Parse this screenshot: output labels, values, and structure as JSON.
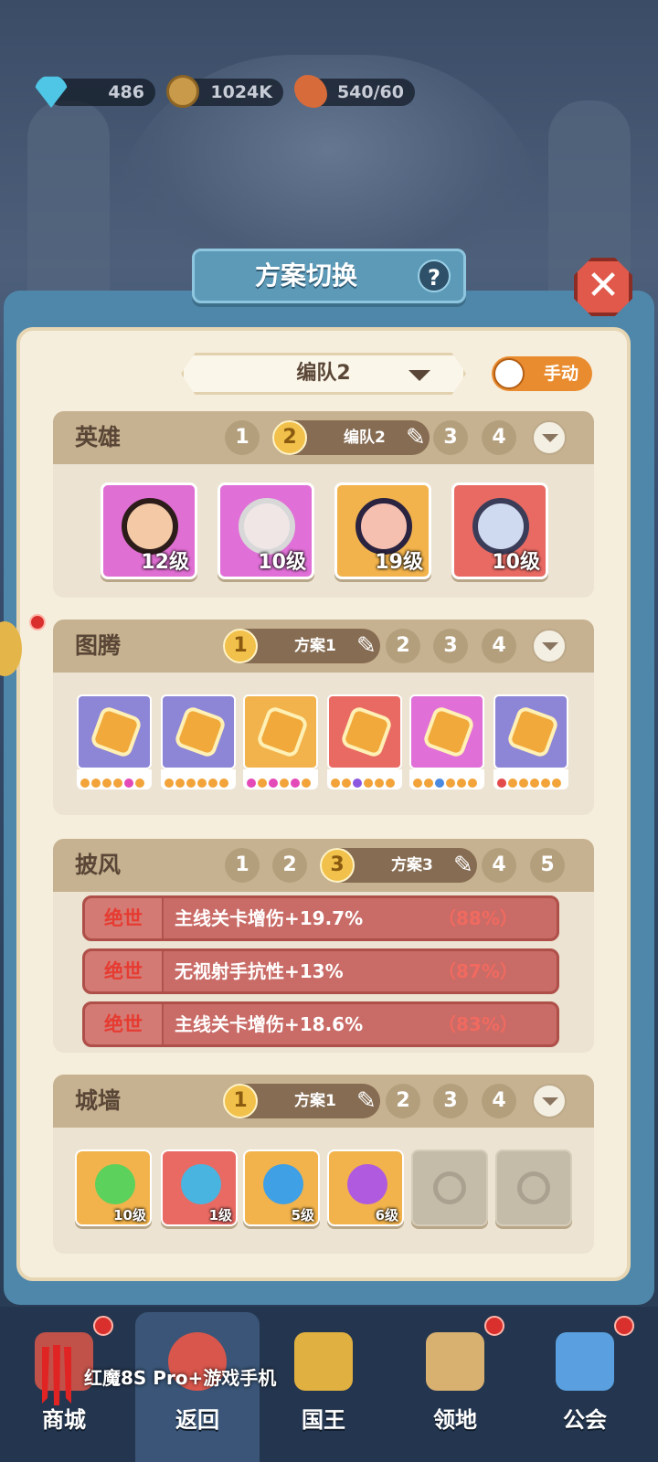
{
  "resources": [
    {
      "icon": "diamond-icon",
      "value": "486"
    },
    {
      "icon": "coin-icon",
      "value": "1024K"
    },
    {
      "icon": "meat-icon",
      "value": "540/60"
    }
  ],
  "dialog": {
    "title": "方案切换",
    "help": "?",
    "close": "✕"
  },
  "team_select": {
    "value": "编队2",
    "toggle_label": "手动"
  },
  "heroes": {
    "title": "英雄",
    "tabs": [
      "1",
      "2",
      "3",
      "4"
    ],
    "active_tab": "2",
    "active_label": "编队2",
    "cards": [
      {
        "level": "12级",
        "bg": "#e06fd3"
      },
      {
        "level": "10级",
        "bg": "#e070d7"
      },
      {
        "level": "19级",
        "bg": "#f2b34c"
      },
      {
        "level": "10级",
        "bg": "#e86a63"
      }
    ]
  },
  "totems": {
    "title": "图腾",
    "tabs": [
      "1",
      "2",
      "3",
      "4"
    ],
    "active_tab": "1",
    "active_label": "方案1",
    "cards": [
      {
        "bg": "#8d86d6",
        "dots": [
          "#f2a43a",
          "#f2a43a",
          "#f2a43a",
          "#f2a43a",
          "#e34ab8",
          "#f2a43a"
        ]
      },
      {
        "bg": "#8d86d6",
        "dots": [
          "#f2a43a",
          "#f2a43a",
          "#f2a43a",
          "#f2a43a",
          "#f2a43a",
          "#f2a43a"
        ]
      },
      {
        "bg": "#f2b34c",
        "dots": [
          "#e34ab8",
          "#f2a43a",
          "#e34ab8",
          "#f2a43a",
          "#e34ab8",
          "#f2a43a"
        ]
      },
      {
        "bg": "#e86a63",
        "dots": [
          "#f2a43a",
          "#f2a43a",
          "#8b57e0",
          "#f2a43a",
          "#f2a43a",
          "#f2a43a"
        ]
      },
      {
        "bg": "#e070d7",
        "dots": [
          "#f2a43a",
          "#f2a43a",
          "#4a8ae0",
          "#f2a43a",
          "#f2a43a",
          "#f2a43a"
        ]
      },
      {
        "bg": "#8d86d6",
        "dots": [
          "#e34a4a",
          "#f2a43a",
          "#f2a43a",
          "#f2a43a",
          "#f2a43a",
          "#f2a43a"
        ]
      }
    ]
  },
  "capes": {
    "title": "披风",
    "tabs": [
      "1",
      "2",
      "3",
      "4",
      "5"
    ],
    "active_tab": "3",
    "active_label": "方案3",
    "attributes": [
      {
        "quality": "绝世",
        "text": "主线关卡增伤+19.7%",
        "percent": "（88%）"
      },
      {
        "quality": "绝世",
        "text": "无视射手抗性+13%",
        "percent": "（87%）"
      },
      {
        "quality": "绝世",
        "text": "主线关卡增伤+18.6%",
        "percent": "（83%）"
      }
    ]
  },
  "walls": {
    "title": "城墙",
    "tabs": [
      "1",
      "2",
      "3",
      "4"
    ],
    "active_tab": "1",
    "active_label": "方案1",
    "cards": [
      {
        "level": "10级",
        "bg": "#f2b34c",
        "icon_color": "#5cd15c"
      },
      {
        "level": "1级",
        "bg": "#e86a63",
        "icon_color": "#4ab4e0"
      },
      {
        "level": "5级",
        "bg": "#f2b34c",
        "icon_color": "#3fa0e6"
      },
      {
        "level": "6级",
        "bg": "#f2b34c",
        "icon_color": "#b05ae0"
      },
      {
        "level": "",
        "locked": true
      },
      {
        "level": "",
        "locked": true
      }
    ]
  },
  "nav": [
    {
      "label": "商城",
      "icon": "shop-icon",
      "badge": true
    },
    {
      "label": "返回",
      "icon": "back-icon",
      "badge": false
    },
    {
      "label": "国王",
      "icon": "crown-icon",
      "badge": false
    },
    {
      "label": "领地",
      "icon": "castle-icon",
      "badge": true
    },
    {
      "label": "公会",
      "icon": "planet-icon",
      "badge": true
    }
  ],
  "watermark": "红魔8S Pro+游戏手机"
}
